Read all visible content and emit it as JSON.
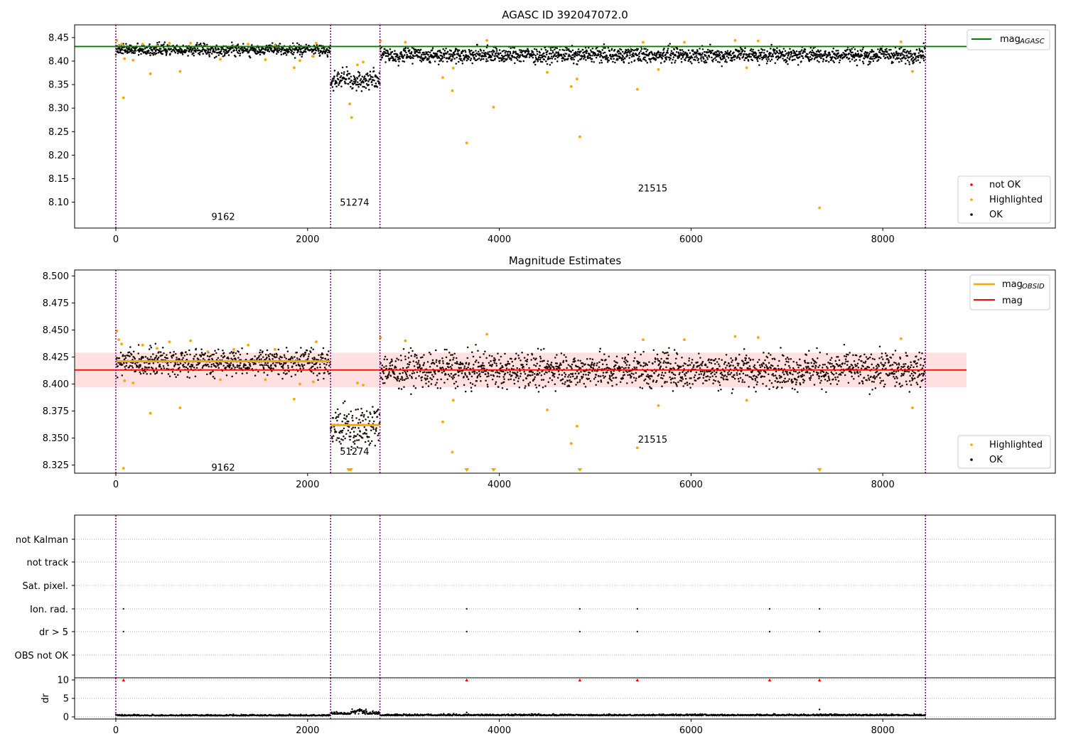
{
  "colors": {
    "ok": "#000000",
    "highlighted": "#ffa500",
    "not_ok": "#ff0000",
    "mag_agasc_line": "#008000",
    "mag_line": "#ff0000",
    "mag_band": "#ffcccc",
    "mag_obsid": "#ffa500",
    "obsid_divider": "#800080",
    "grid": "#b0b0b0"
  },
  "chart_data": [
    {
      "type": "scatter",
      "title": "AGASC ID 392047072.0",
      "xlabel": "",
      "ylabel": "",
      "xlim": [
        -430,
        9800
      ],
      "ylim": [
        8.045,
        8.477
      ],
      "xticks": [
        "0",
        "2000",
        "4000",
        "6000",
        "8000"
      ],
      "yticks": [
        "8.10",
        "8.15",
        "8.20",
        "8.25",
        "8.30",
        "8.35",
        "8.40",
        "8.45"
      ],
      "legend_position": "top-right + bottom-right",
      "legend": {
        "lines": [
          "mag",
          "AGASC"
        ],
        "points": [
          "not OK",
          "Highlighted",
          "OK"
        ]
      },
      "mag_agasc": 8.431,
      "obsid_boundaries": [
        0,
        2240,
        2755,
        8445
      ],
      "obsid_labels": [
        {
          "text": "9162",
          "x": 1120,
          "y": 8.07
        },
        {
          "text": "51274",
          "x": 2490,
          "y": 8.1
        },
        {
          "text": "21515",
          "x": 5600,
          "y": 8.13
        }
      ],
      "ok_segments": [
        {
          "x0": 0,
          "x1": 2240,
          "center": 8.424,
          "spread": 0.006
        },
        {
          "x0": 2240,
          "x1": 2755,
          "center": 8.36,
          "spread": 0.01
        },
        {
          "x0": 2755,
          "x1": 8445,
          "center": 8.413,
          "spread": 0.008
        }
      ],
      "highlighted_points": [
        [
          10,
          8.444
        ],
        [
          30,
          8.432
        ],
        [
          60,
          8.436
        ],
        [
          80,
          8.322
        ],
        [
          90,
          8.405
        ],
        [
          180,
          8.402
        ],
        [
          280,
          8.436
        ],
        [
          360,
          8.373
        ],
        [
          430,
          8.432
        ],
        [
          560,
          8.438
        ],
        [
          670,
          8.378
        ],
        [
          780,
          8.438
        ],
        [
          960,
          8.43
        ],
        [
          1090,
          8.404
        ],
        [
          1230,
          8.432
        ],
        [
          1380,
          8.436
        ],
        [
          1560,
          8.403
        ],
        [
          1660,
          8.433
        ],
        [
          1860,
          8.386
        ],
        [
          1920,
          8.401
        ],
        [
          2060,
          8.41
        ],
        [
          2090,
          8.438
        ],
        [
          2440,
          8.309
        ],
        [
          2460,
          8.28
        ],
        [
          2520,
          8.392
        ],
        [
          2580,
          8.398
        ],
        [
          2760,
          8.443
        ],
        [
          3020,
          8.44
        ],
        [
          3410,
          8.365
        ],
        [
          3510,
          8.337
        ],
        [
          3520,
          8.385
        ],
        [
          3660,
          8.226
        ],
        [
          3870,
          8.444
        ],
        [
          3940,
          8.302
        ],
        [
          4500,
          8.376
        ],
        [
          4750,
          8.346
        ],
        [
          4810,
          8.362
        ],
        [
          4840,
          8.239
        ],
        [
          5440,
          8.34
        ],
        [
          5500,
          8.44
        ],
        [
          5660,
          8.382
        ],
        [
          5820,
          8.43
        ],
        [
          5930,
          8.44
        ],
        [
          6460,
          8.444
        ],
        [
          6580,
          8.386
        ],
        [
          6700,
          8.443
        ],
        [
          7340,
          8.088
        ],
        [
          8190,
          8.441
        ],
        [
          8310,
          8.378
        ]
      ]
    },
    {
      "type": "scatter",
      "title": "Magnitude Estimates",
      "xlabel": "",
      "ylabel": "",
      "xlim": [
        -430,
        9800
      ],
      "ylim": [
        8.3175,
        8.5055
      ],
      "xticks": [
        "0",
        "2000",
        "4000",
        "6000",
        "8000"
      ],
      "yticks": [
        "8.325",
        "8.350",
        "8.375",
        "8.400",
        "8.425",
        "8.450",
        "8.475",
        "8.500"
      ],
      "legend_position": "top-right + bottom-right",
      "legend": {
        "lines": [
          "mag",
          "OBSID",
          "mag"
        ],
        "points": [
          "Highlighted",
          "OK"
        ]
      },
      "mag": 8.413,
      "mag_band": [
        8.397,
        8.429
      ],
      "mag_obsid": [
        {
          "x0": 0,
          "x1": 2240,
          "value": 8.421
        },
        {
          "x0": 2240,
          "x1": 2755,
          "value": 8.362
        }
      ],
      "obsid_boundaries": [
        0,
        2240,
        2755,
        8445
      ],
      "obsid_labels": [
        {
          "text": "9162",
          "x": 1120,
          "y": 8.323
        },
        {
          "text": "51274",
          "x": 2490,
          "y": 8.338
        },
        {
          "text": "21515",
          "x": 5600,
          "y": 8.349
        }
      ],
      "ok_segments": [
        {
          "x0": 0,
          "x1": 2240,
          "center": 8.42,
          "spread": 0.006
        },
        {
          "x0": 2240,
          "x1": 2755,
          "center": 8.36,
          "spread": 0.009
        },
        {
          "x0": 2755,
          "x1": 8445,
          "center": 8.413,
          "spread": 0.008
        }
      ],
      "highlighted_points": [
        [
          10,
          8.449
        ],
        [
          30,
          8.441
        ],
        [
          60,
          8.437
        ],
        [
          80,
          8.322
        ],
        [
          90,
          8.403
        ],
        [
          180,
          8.401
        ],
        [
          280,
          8.436
        ],
        [
          360,
          8.373
        ],
        [
          430,
          8.433
        ],
        [
          560,
          8.439
        ],
        [
          670,
          8.378
        ],
        [
          780,
          8.44
        ],
        [
          960,
          8.43
        ],
        [
          1090,
          8.404
        ],
        [
          1230,
          8.432
        ],
        [
          1380,
          8.436
        ],
        [
          1560,
          8.404
        ],
        [
          1660,
          8.432
        ],
        [
          1860,
          8.386
        ],
        [
          1920,
          8.4
        ],
        [
          2060,
          8.402
        ],
        [
          2090,
          8.439
        ],
        [
          2520,
          8.401
        ],
        [
          2580,
          8.399
        ],
        [
          2760,
          8.443
        ],
        [
          3020,
          8.44
        ],
        [
          3410,
          8.365
        ],
        [
          3510,
          8.337
        ],
        [
          3520,
          8.385
        ],
        [
          3870,
          8.446
        ],
        [
          4500,
          8.376
        ],
        [
          4750,
          8.345
        ],
        [
          4810,
          8.361
        ],
        [
          5440,
          8.341
        ],
        [
          5500,
          8.441
        ],
        [
          5660,
          8.38
        ],
        [
          5930,
          8.441
        ],
        [
          6460,
          8.444
        ],
        [
          6580,
          8.385
        ],
        [
          6700,
          8.443
        ],
        [
          8190,
          8.442
        ],
        [
          8310,
          8.378
        ]
      ],
      "clipped_low_x": [
        2430,
        2450,
        3660,
        3940,
        4840,
        7340
      ]
    },
    {
      "type": "scatter",
      "title": "",
      "xlabel": "",
      "ylabel": "",
      "flag_categories": [
        "not Kalman",
        "not track",
        "Sat. pixel.",
        "Ion. rad.",
        "dr > 5",
        "OBS not OK"
      ],
      "flag_points": {
        "Ion. rad.": [
          80,
          3660,
          4840,
          5440,
          6820,
          7340
        ],
        "dr > 5": [
          80,
          3660,
          4840,
          5440,
          6820,
          7340
        ]
      },
      "obsid_boundaries": [
        0,
        2240,
        2755,
        8445
      ]
    },
    {
      "type": "scatter",
      "title": "",
      "xlabel": "",
      "ylabel": "dr",
      "xlim": [
        -430,
        9800
      ],
      "ylim": [
        -1,
        10.5
      ],
      "xticks": [
        "0",
        "2000",
        "4000",
        "6000",
        "8000"
      ],
      "yticks": [
        "0",
        "5",
        "10"
      ],
      "red_markers_x": [
        80,
        3660,
        4840,
        5440,
        6820,
        7340
      ],
      "red_markers_y": 10,
      "outliers": [
        [
          3660,
          1.2
        ],
        [
          7340,
          2.0
        ],
        [
          2540,
          1.5
        ],
        [
          2590,
          1.3
        ]
      ],
      "segments": [
        {
          "x0": 0,
          "x1": 2240,
          "center": 0.3,
          "spread": 0.15
        },
        {
          "x0": 2240,
          "x1": 2755,
          "center": 0.7,
          "spread": 0.3
        },
        {
          "x0": 2755,
          "x1": 8445,
          "center": 0.35,
          "spread": 0.18
        }
      ],
      "obsid_boundaries": [
        0,
        2240,
        2755,
        8445
      ]
    }
  ]
}
